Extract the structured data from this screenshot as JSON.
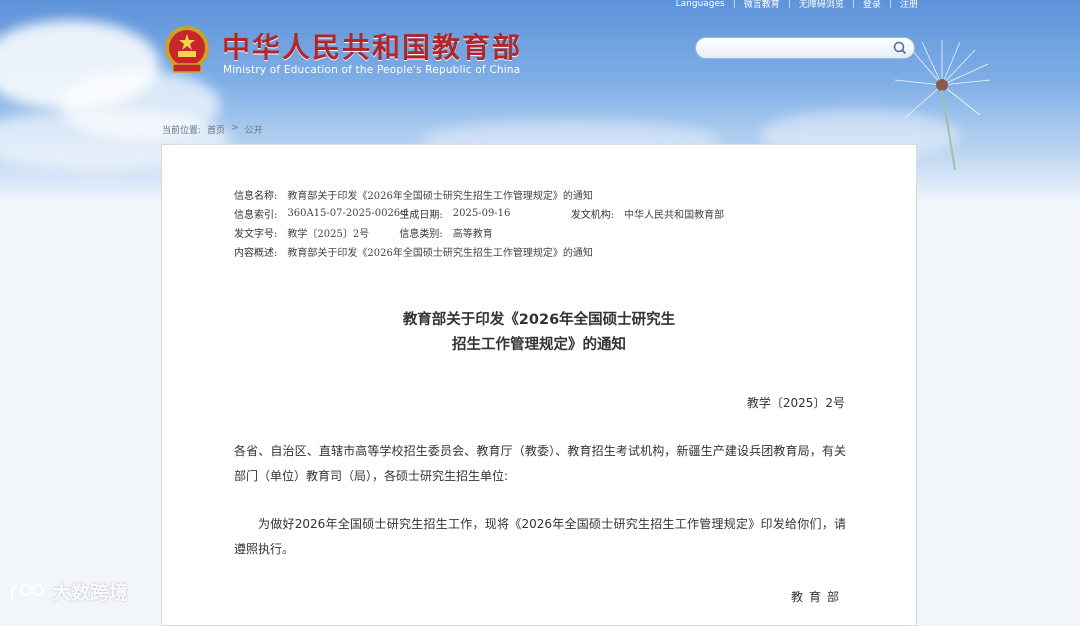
{
  "header": {
    "title_cn": "中华人民共和国教育部",
    "title_en": "Ministry of Education of the People's Republic of China",
    "links": [
      "Languages",
      "微言教育",
      "无障碍浏览",
      "登录",
      "注册"
    ],
    "search_placeholder": ""
  },
  "breadcrumb": {
    "label": "当前位置:",
    "items": [
      "首页",
      "公开"
    ],
    "separator": ">"
  },
  "meta": {
    "name_label": "信息名称:",
    "name_value": "教育部关于印发《2026年全国硕士研究生招生工作管理规定》的通知",
    "index_label": "信息索引:",
    "index_value": "360A15-07-2025-0026-1",
    "date_label": "生成日期:",
    "date_value": "2025-09-16",
    "org_label": "发文机构:",
    "org_value": "中华人民共和国教育部",
    "docno_label": "发文字号:",
    "docno_value": "教学〔2025〕2号",
    "category_label": "信息类别:",
    "category_value": "高等教育",
    "summary_label": "内容概述:",
    "summary_value": "教育部关于印发《2026年全国硕士研究生招生工作管理规定》的通知"
  },
  "document": {
    "title_line1": "教育部关于印发《2026年全国硕士研究生",
    "title_line2": "招生工作管理规定》的通知",
    "doc_number": "教学〔2025〕2号",
    "addressees": "各省、自治区、直辖市高等学校招生委员会、教育厅（教委）、教育招生考试机构，新疆生产建设兵团教育局，有关部门（单位）教育司（局），各硕士研究生招生单位:",
    "body": "为做好2026年全国硕士研究生招生工作，现将《2026年全国硕士研究生招生工作管理规定》印发给你们，请遵照执行。",
    "signer": "教育部"
  },
  "watermark": {
    "text": "大数跨境"
  },
  "colors": {
    "title_red": "#b0262a",
    "sky_blue": "#5e93d9"
  }
}
